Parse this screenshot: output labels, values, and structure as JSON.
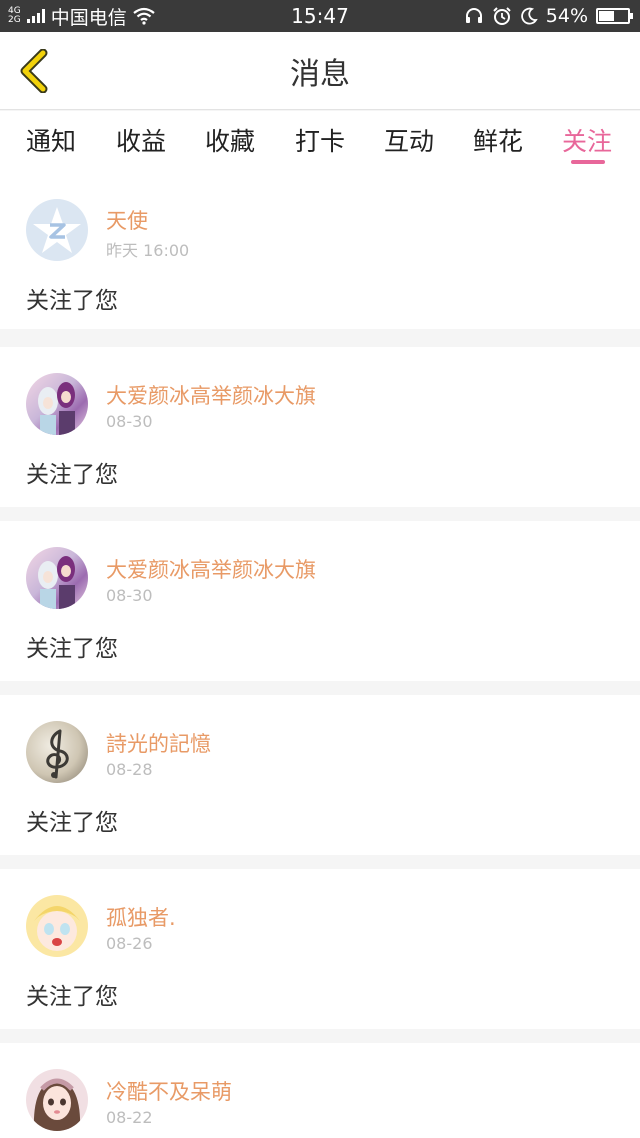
{
  "status_bar": {
    "network_top": "4G",
    "network_bottom": "2G",
    "carrier": "中国电信",
    "time": "15:47",
    "battery_percent_label": "54%",
    "battery_level": 0.54,
    "icons": [
      "signal-icon",
      "wifi-icon",
      "headset-icon",
      "alarm-icon",
      "moon-icon",
      "battery-icon"
    ]
  },
  "header": {
    "back_icon": "chevron-left-icon",
    "title": "消息"
  },
  "tabs": [
    {
      "label": "通知",
      "active": false
    },
    {
      "label": "收益",
      "active": false
    },
    {
      "label": "收藏",
      "active": false
    },
    {
      "label": "打卡",
      "active": false
    },
    {
      "label": "互动",
      "active": false
    },
    {
      "label": "鲜花",
      "active": false
    },
    {
      "label": "关注",
      "active": true
    }
  ],
  "colors": {
    "accent": "#e8679a",
    "username": "#e89a66",
    "timestamp": "#bdbdbd",
    "background": "#f5f5f5"
  },
  "messages": [
    {
      "user": "天使",
      "time": "昨天 16:00",
      "text": "关注了您",
      "avatar": "qzone-star-avatar"
    },
    {
      "user": "大爱颜冰高举颜冰大旗",
      "time": "08-30",
      "text": "关注了您",
      "avatar": "anime-girls-avatar"
    },
    {
      "user": "大爱颜冰高举颜冰大旗",
      "time": "08-30",
      "text": "关注了您",
      "avatar": "anime-girls-avatar"
    },
    {
      "user": "詩光的記憶",
      "time": "08-28",
      "text": "关注了您",
      "avatar": "treble-clef-avatar"
    },
    {
      "user": "孤独者.",
      "time": "08-26",
      "text": "关注了您",
      "avatar": "crying-girl-avatar"
    },
    {
      "user": "冷酷不及呆萌",
      "time": "08-22",
      "text": "",
      "avatar": "doll-girl-avatar"
    }
  ]
}
